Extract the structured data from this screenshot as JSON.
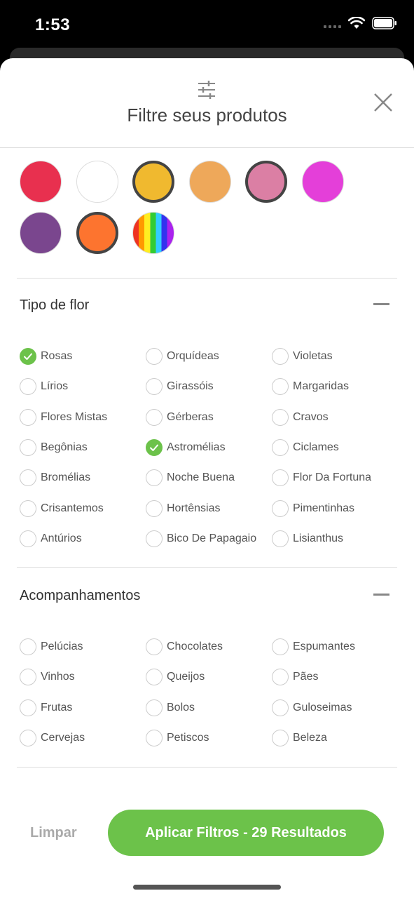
{
  "status_bar": {
    "time": "1:53"
  },
  "header": {
    "title": "Filtre seus produtos",
    "filter_icon": "sliders-icon",
    "close_icon": "close-icon"
  },
  "colors": [
    {
      "hex": "#e8304f",
      "selected": false
    },
    {
      "hex": "#ffffff",
      "selected": false
    },
    {
      "hex": "#f0b92f",
      "selected": true
    },
    {
      "hex": "#eea85a",
      "selected": false
    },
    {
      "hex": "#db7fa4",
      "selected": true
    },
    {
      "hex": "#e43fd9",
      "selected": false
    },
    {
      "hex": "#7a468e",
      "selected": false
    },
    {
      "hex": "#fd742f",
      "selected": true
    },
    {
      "hex": "rainbow",
      "selected": false
    }
  ],
  "flower_section": {
    "title": "Tipo de flor",
    "options": [
      {
        "label": "Rosas",
        "checked": true
      },
      {
        "label": "Orquídeas",
        "checked": false
      },
      {
        "label": "Violetas",
        "checked": false
      },
      {
        "label": "Lírios",
        "checked": false
      },
      {
        "label": "Girassóis",
        "checked": false
      },
      {
        "label": "Margaridas",
        "checked": false
      },
      {
        "label": "Flores Mistas",
        "checked": false
      },
      {
        "label": "Gérberas",
        "checked": false
      },
      {
        "label": "Cravos",
        "checked": false
      },
      {
        "label": "Begônias",
        "checked": false
      },
      {
        "label": "Astromélias",
        "checked": true
      },
      {
        "label": "Ciclames",
        "checked": false
      },
      {
        "label": "Bromélias",
        "checked": false
      },
      {
        "label": "Noche Buena",
        "checked": false
      },
      {
        "label": "Flor Da Fortuna",
        "checked": false
      },
      {
        "label": "Crisantemos",
        "checked": false
      },
      {
        "label": "Hortênsias",
        "checked": false
      },
      {
        "label": "Pimentinhas",
        "checked": false
      },
      {
        "label": "Antúrios",
        "checked": false
      },
      {
        "label": "Bico De Papagaio",
        "checked": false
      },
      {
        "label": "Lisianthus",
        "checked": false
      }
    ]
  },
  "extras_section": {
    "title": "Acompanhamentos",
    "options": [
      {
        "label": "Pelúcias",
        "checked": false
      },
      {
        "label": "Chocolates",
        "checked": false
      },
      {
        "label": "Espumantes",
        "checked": false
      },
      {
        "label": "Vinhos",
        "checked": false
      },
      {
        "label": "Queijos",
        "checked": false
      },
      {
        "label": "Pães",
        "checked": false
      },
      {
        "label": "Frutas",
        "checked": false
      },
      {
        "label": "Bolos",
        "checked": false
      },
      {
        "label": "Guloseimas",
        "checked": false
      },
      {
        "label": "Cervejas",
        "checked": false
      },
      {
        "label": "Petiscos",
        "checked": false
      },
      {
        "label": "Beleza",
        "checked": false
      }
    ]
  },
  "footer": {
    "clear_label": "Limpar",
    "apply_label": "Aplicar Filtros - 29 Resultados"
  }
}
